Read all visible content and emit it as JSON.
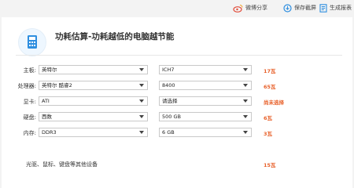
{
  "toolbar": {
    "share_label": "微博分享",
    "save_label": "保存截屏",
    "report_label": "生成报表"
  },
  "header": {
    "title": "功耗估算-功耗越低的电脑越节能"
  },
  "rows": [
    {
      "label": "主板:",
      "select1": "英特尔",
      "select2": "ICH7",
      "power": "17瓦"
    },
    {
      "label": "处理器:",
      "select1": "英特尔 酷睿2",
      "select2": "8400",
      "power": "65瓦"
    },
    {
      "label": "显卡:",
      "select1": "ATI",
      "select2": "请选择",
      "power": "尚未选择"
    },
    {
      "label": "硬盘:",
      "select1": "西数",
      "select2": "500 GB",
      "power": "6瓦"
    },
    {
      "label": "内存:",
      "select1": "DDR3",
      "select2": "6 GB",
      "power": "3瓦"
    }
  ],
  "footer": {
    "label": "光驱、鼠标、键盘等其他设备",
    "power": "15瓦"
  },
  "colors": {
    "accent": "#2d8ee0",
    "power": "#e8622c"
  },
  "icons": [
    "weibo-icon",
    "save-screenshot-icon",
    "report-icon",
    "calculator-icon"
  ]
}
